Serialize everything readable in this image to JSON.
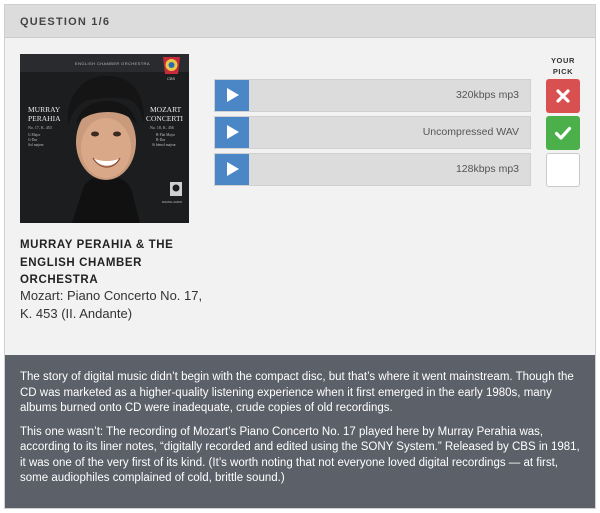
{
  "header": {
    "title": "QUESTION 1/6"
  },
  "album": {
    "cover": {
      "top_banner": "ENGLISH CHAMBER ORCHESTRA",
      "left_name_1": "MURRAY",
      "left_name_2": "PERAHIA",
      "left_detail_1": "No. 17, K. 453",
      "left_detail_2": "G Major",
      "left_detail_3": "G-Dur",
      "left_detail_4": "Sol majeur",
      "right_title_1": "MOZART",
      "right_title_2": "CONCERTI",
      "right_detail_1": "No. 18, K. 456",
      "right_detail_2": "B-Flat Major",
      "right_detail_3": "B-Dur",
      "right_detail_4": "Si bémol majeur",
      "label_logo": "CBS",
      "cd_logo": "DIGITAL AUDIO"
    }
  },
  "artist": "MURRAY PERAHIA & THE ENGLISH CHAMBER ORCHESTRA",
  "track": "Mozart: Piano Concerto No. 17, K. 453 (II. Andante)",
  "pick_label": "YOUR PICK",
  "options": [
    {
      "label": "320kbps mp3",
      "pick_state": "wrong",
      "icon": "x-icon"
    },
    {
      "label": "Uncompressed WAV",
      "pick_state": "correct",
      "icon": "check-icon"
    },
    {
      "label": "128kbps mp3",
      "pick_state": "empty",
      "icon": ""
    }
  ],
  "explanation": [
    "The story of digital music didn’t begin with the compact disc, but that’s where it went mainstream. Though the CD was marketed as a higher-quality listening experience when it first emerged in the early 1980s, many albums burned onto CD were inadequate, crude copies of old recordings.",
    "This one wasn’t: The recording of Mozart’s Piano Concerto No. 17 played here by Murray Perahia was, according to its liner notes, “digitally recorded and edited using the SONY System.” Released by CBS in 1981, it was one of the very first of its kind. (It’s worth noting that not everyone loved digital recordings — at first, some audiophiles complained of cold, brittle sound.)"
  ],
  "colors": {
    "play_button": "#4b87c7",
    "wrong": "#d95050",
    "correct": "#4cb04a",
    "explanation_bg": "#5c6069",
    "header_bg": "#dcdcdc"
  }
}
